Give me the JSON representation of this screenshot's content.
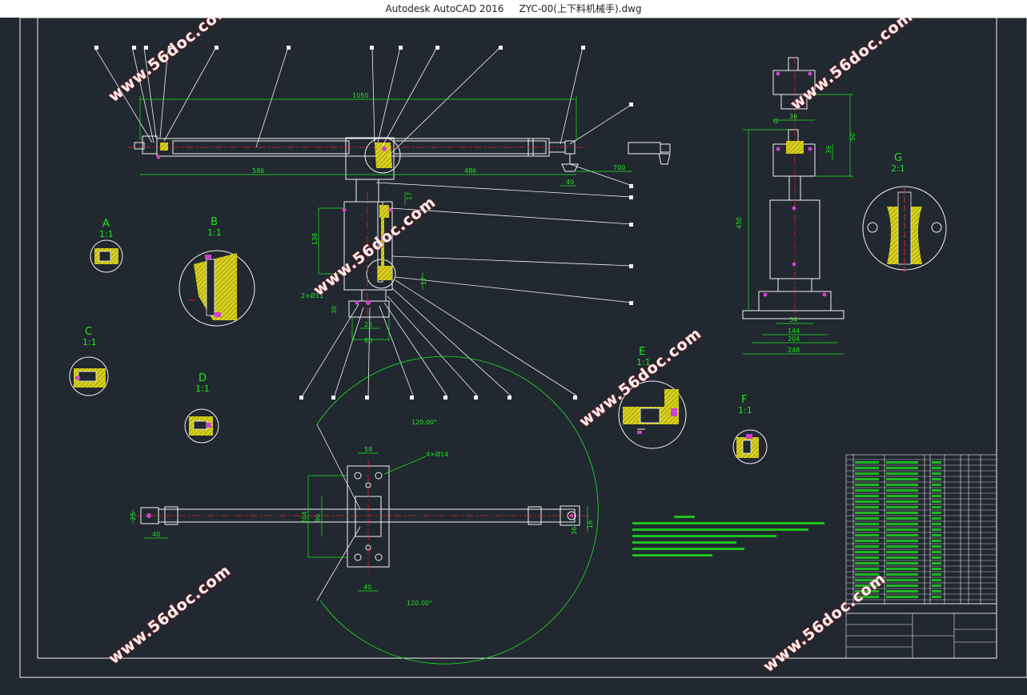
{
  "window": {
    "app_name": "Autodesk AutoCAD 2016",
    "file_name": "ZYC-00(上下料机械手).dwg"
  },
  "watermark": {
    "text": "www.56doc.com"
  },
  "views": {
    "A": {
      "label": "A",
      "scale": "1:1"
    },
    "B": {
      "label": "B",
      "scale": "1:1"
    },
    "C": {
      "label": "C",
      "scale": "1:1"
    },
    "D": {
      "label": "D",
      "scale": "1:1"
    },
    "E": {
      "label": "E",
      "scale": "1:1"
    },
    "F": {
      "label": "F",
      "scale": "1:1"
    },
    "G": {
      "label": "G",
      "scale": "2:1"
    }
  },
  "dimensions": {
    "overall_length": "1050",
    "left_arm": "586",
    "right_arm": "486",
    "end_offset": "700",
    "end_width": "40",
    "col_height": "138",
    "holes": "2×Ø11",
    "base_h": "30",
    "base_w1": "26",
    "base_w2": "80",
    "top_w": "36",
    "top_h": "36",
    "top_off": "50",
    "side_height": "450",
    "base_54": "54",
    "base_144": "144",
    "base_204": "204",
    "base_248": "248",
    "plan_58": "58",
    "plan_holes": "4×Ø14",
    "plan_204": "204",
    "plan_90": "90",
    "plan_40a": "40",
    "plan_40b": "40",
    "plan_25": "25",
    "plan_16": "16",
    "plan_36": "36",
    "angle_top": "120.00°",
    "angle_bottom": "120.00°"
  },
  "colors": {
    "background": "#212830",
    "line": "#f2f2f2",
    "dimension": "#1de81d",
    "section_fill": "#d8d01c",
    "center_line": "#e0202a",
    "bolt": "#d040d0"
  }
}
